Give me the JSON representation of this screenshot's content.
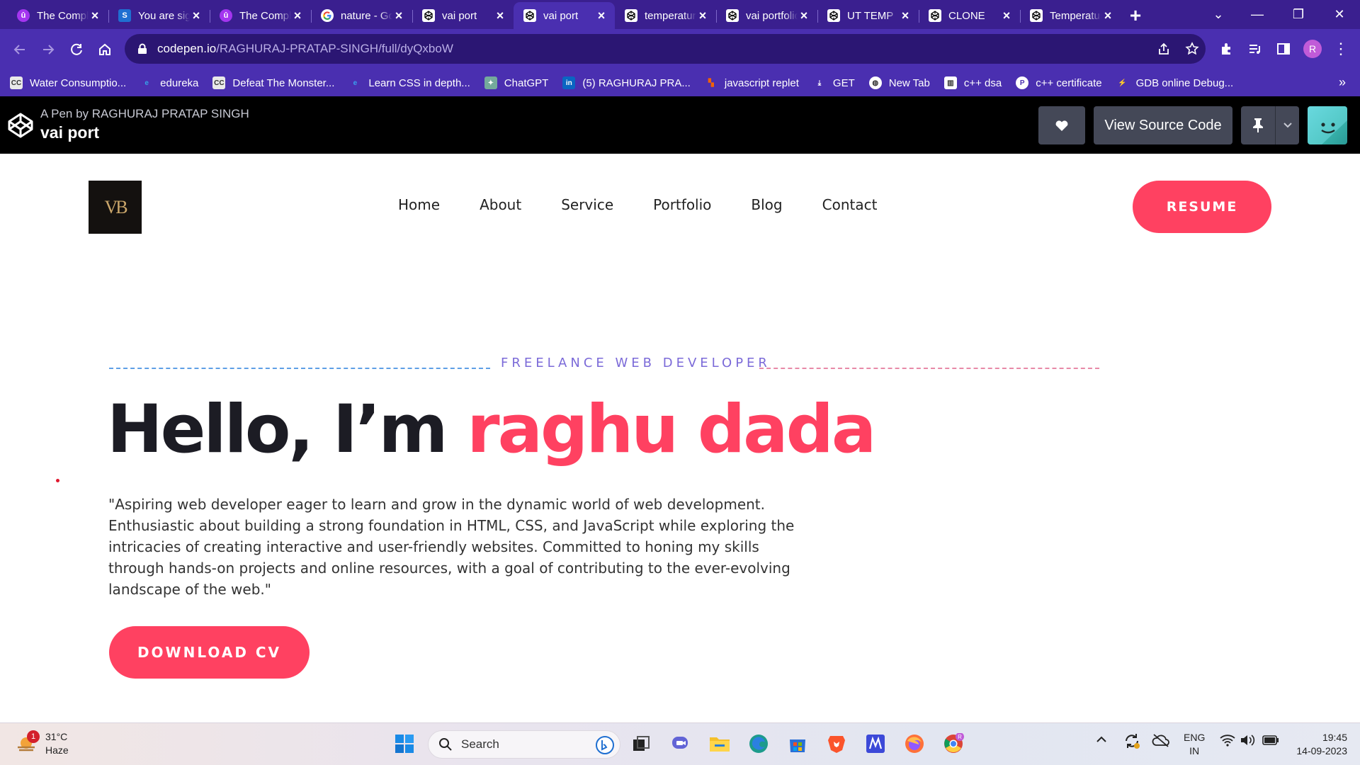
{
  "browser": {
    "tabs": [
      {
        "title": "The Complete",
        "icon": "udemy-icon"
      },
      {
        "title": "You are signed",
        "icon": "s-icon"
      },
      {
        "title": "The Complete",
        "icon": "udemy-icon"
      },
      {
        "title": "nature - Google",
        "icon": "google-icon"
      },
      {
        "title": "vai port",
        "icon": "codepen-icon"
      },
      {
        "title": "vai port",
        "icon": "codepen-icon",
        "active": true
      },
      {
        "title": "temperature",
        "icon": "codepen-icon"
      },
      {
        "title": "vai portfolio",
        "icon": "codepen-icon"
      },
      {
        "title": "UT TEMP",
        "icon": "codepen-icon"
      },
      {
        "title": "CLONE",
        "icon": "codepen-icon"
      },
      {
        "title": "Temperature",
        "icon": "codepen-icon"
      }
    ],
    "url_host": "codepen.io",
    "url_path": "/RAGHURAJ-PRATAP-SINGH/full/dyQxboW",
    "profile_initial": "R",
    "bookmarks": [
      {
        "label": "Water Consumptio...",
        "icon": "cc-icon"
      },
      {
        "label": "edureka",
        "icon": "edureka-icon"
      },
      {
        "label": "Defeat The Monster...",
        "icon": "cc-icon"
      },
      {
        "label": "Learn CSS in depth...",
        "icon": "edge-icon"
      },
      {
        "label": "ChatGPT",
        "icon": "chatgpt-icon"
      },
      {
        "label": "(5) RAGHURAJ PRA...",
        "icon": "linkedin-icon"
      },
      {
        "label": "javascript replet",
        "icon": "replit-icon"
      },
      {
        "label": "GET",
        "icon": "download-icon"
      },
      {
        "label": "New Tab",
        "icon": "globe-icon"
      },
      {
        "label": "c++ dsa",
        "icon": "book-icon"
      },
      {
        "label": "c++ certificate",
        "icon": "p-icon"
      },
      {
        "label": "GDB online Debug...",
        "icon": "gdb-icon"
      }
    ],
    "more_bookmarks": "»"
  },
  "codepen": {
    "by_line": "A Pen by RAGHURAJ PRATAP SINGH",
    "pen_title": "vai port",
    "view_source": "View Source Code"
  },
  "site": {
    "logo_text": "VB",
    "nav": [
      "Home",
      "About",
      "Service",
      "Portfolio",
      "Blog",
      "Contact"
    ],
    "resume_label": "RESUME",
    "tagline": "FREELANCE WEB DEVELOPER",
    "hero_greeting": "Hello, I’m",
    "hero_name": "raghu dada",
    "bio": "\"Aspiring web developer eager to learn and grow in the dynamic world of web development. Enthusiastic about building a strong foundation in HTML, CSS, and JavaScript while exploring the intricacies of creating interactive and user-friendly websites. Committed to honing my skills through hands-on projects and online resources, with a goal of contributing to the ever-evolving landscape of the web.\"",
    "download_cv_label": "DOWNLOAD CV",
    "accent_color": "#ff4161"
  },
  "taskbar": {
    "weather_temp": "31°C",
    "weather_desc": "Haze",
    "weather_badge": "1",
    "search_placeholder": "Search",
    "lang_line1": "ENG",
    "lang_line2": "IN",
    "time": "19:45",
    "date": "14-09-2023"
  }
}
